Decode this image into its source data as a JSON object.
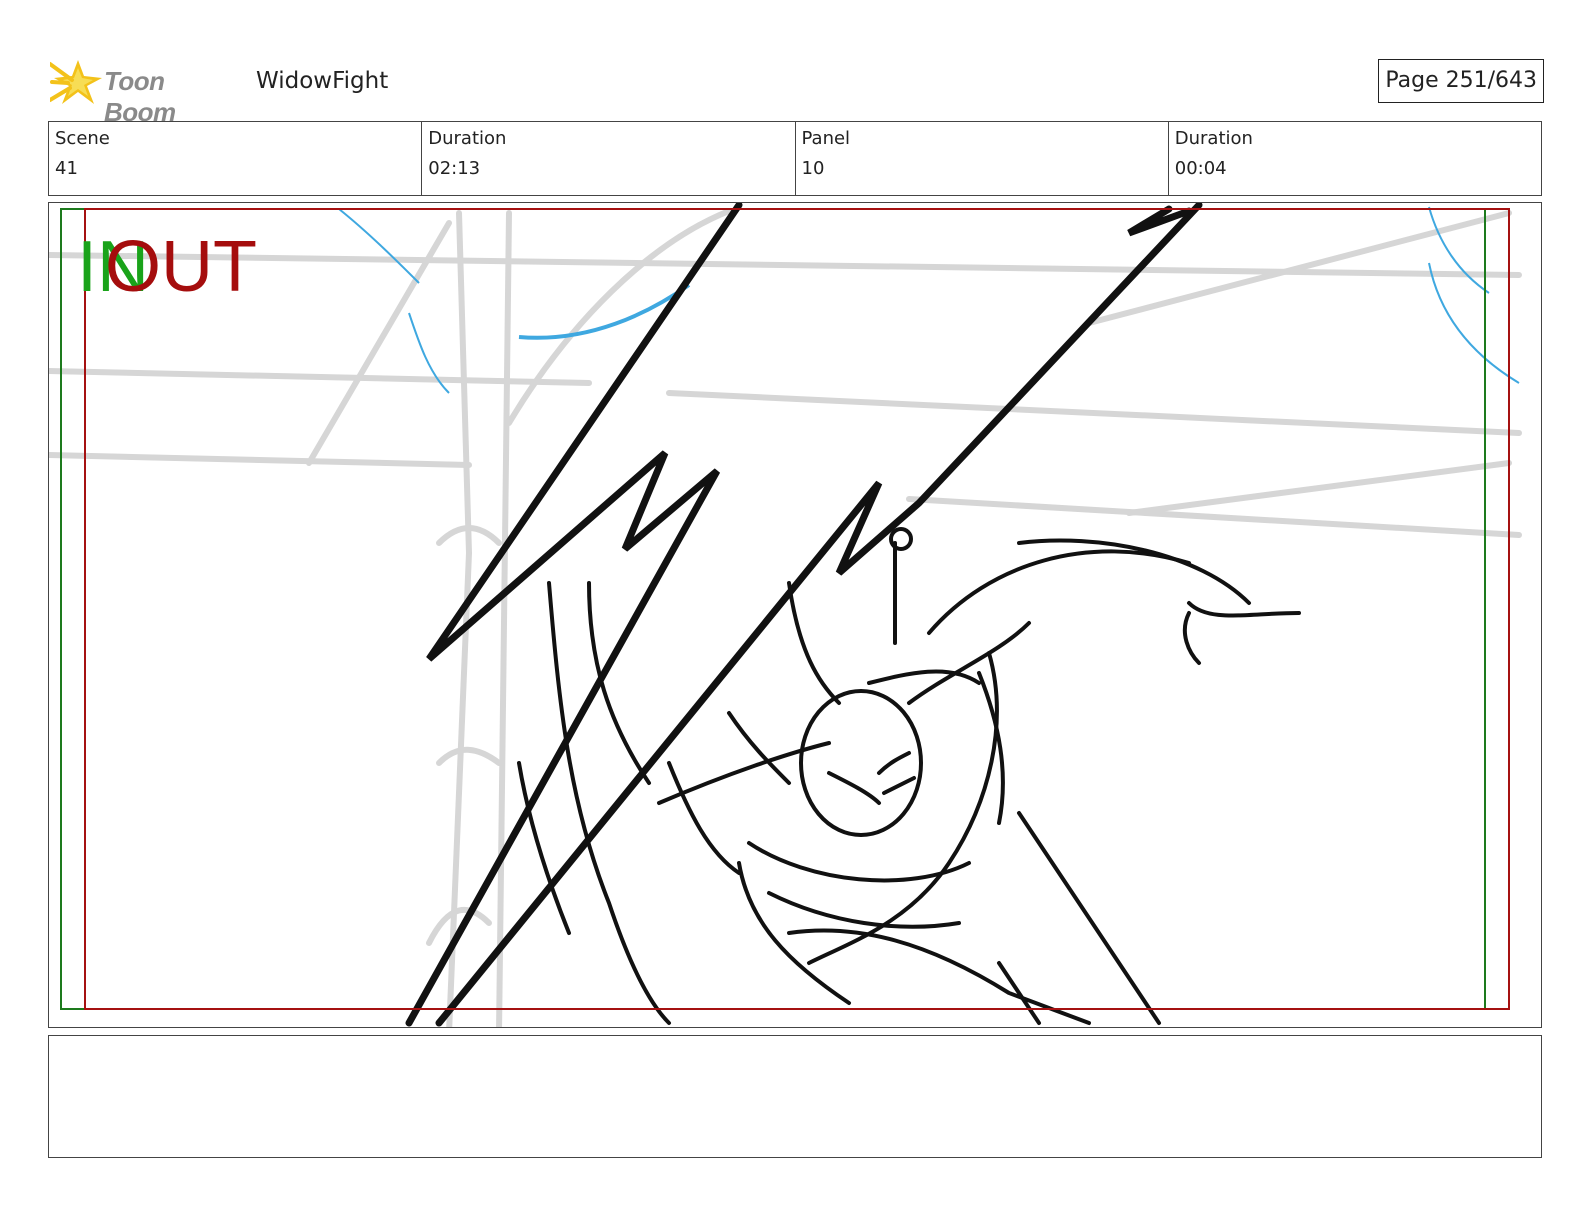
{
  "header": {
    "logo_text": "Toon Boom",
    "project_title": "WidowFight",
    "page_label": "Page 251/643"
  },
  "info": {
    "scene_label": "Scene",
    "scene_value": "41",
    "scene_duration_label": "Duration",
    "scene_duration_value": "02:13",
    "panel_label": "Panel",
    "panel_value": "10",
    "panel_duration_label": "Duration",
    "panel_duration_value": "00:04"
  },
  "panel": {
    "in_marker": "IN",
    "out_marker": "OUT",
    "in_color": "#1aa31a",
    "out_color": "#a50d0d"
  },
  "notes": {
    "text": ""
  },
  "icons": {
    "logo": "toon-boom-star-icon"
  }
}
